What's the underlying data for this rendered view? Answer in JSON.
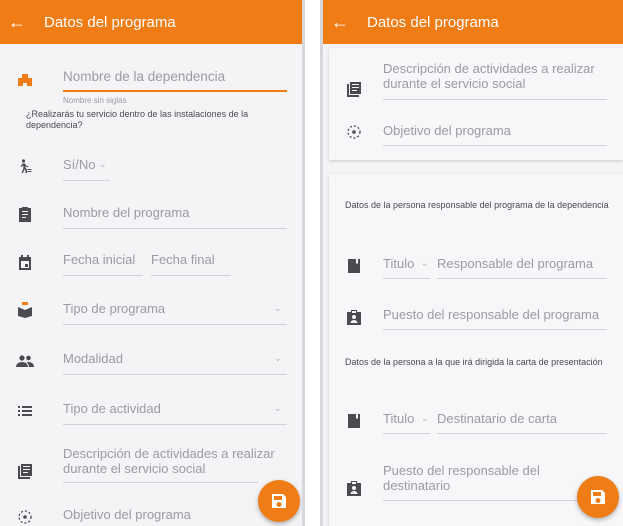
{
  "left_screen": {
    "title": "Datos del programa",
    "dependencia_placeholder": "Nombre de la dependencia",
    "dependencia_helper": "Nombre sin siglas",
    "question": "¿Realizarás tu servicio dentro de las instalaciones de la dependencia?",
    "si_no": "Sí/No",
    "programa_placeholder": "Nombre del programa",
    "fecha_inicial": "Fecha inicial",
    "fecha_final": "Fecha final",
    "tipo_programa": "Tipo de programa",
    "modalidad": "Modalidad",
    "tipo_actividad": "Tipo de actividad",
    "descripcion": "Descripción de actividades a realizar durante el servicio social",
    "objetivo": "Objetivo del programa"
  },
  "right_screen": {
    "title": "Datos del programa",
    "descripcion": "Descripción de actividades a realizar durante el servicio social",
    "objetivo": "Objetivo del programa",
    "responsable_heading": "Datos de la persona responsable del programa de la dependencia",
    "titulo_1": "Titulo",
    "responsable": "Responsable del programa",
    "puesto_responsable": "Puesto del responsable del programa",
    "carta_heading": "Datos de la persona a la que irá dirigida la carta de presentación",
    "titulo_2": "Titulo",
    "destinatario": "Destinatario de carta",
    "puesto_destinatario": "Puesto del responsable del destinatario"
  },
  "colors": {
    "accent": "#f07c16",
    "icon": "#4a4a50",
    "placeholder": "#9b9ba1"
  }
}
